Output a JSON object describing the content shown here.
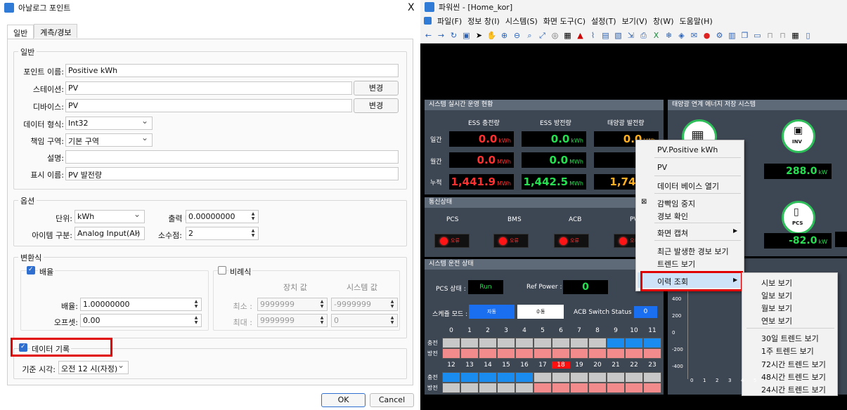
{
  "dialog": {
    "title": "아날로그 포인트",
    "close": "X",
    "tabs": [
      "일반",
      "계측/경보"
    ],
    "general": {
      "title": "일반",
      "point_name_label": "포인트 이름:",
      "point_name": "Positive kWh",
      "station_label": "스테이션:",
      "station": "PV",
      "station_btn": "변경",
      "device_label": "디바이스:",
      "device": "PV",
      "device_btn": "변경",
      "dtype_label": "데이터 형식:",
      "dtype": "Int32",
      "zone_label": "책임 구역:",
      "zone": "기본 구역",
      "desc_label": "설명:",
      "desc": "",
      "display_label": "표시 이름:",
      "display": "PV 발전량"
    },
    "options": {
      "title": "옵션",
      "unit_label": "단위:",
      "unit": "kWh",
      "mult_label": "출력 배율:",
      "mult": "0.00000000",
      "item_label": "아이템 구분:",
      "item": "Analog Input(AI)",
      "dec_label": "소수점:",
      "dec": "2"
    },
    "conversion": {
      "title": "변환식",
      "scale_title": "배율",
      "scale_label": "배율:",
      "scale": "1.00000000",
      "offset_label": "오프셋:",
      "offset": "0.00",
      "ratio_title": "비례식",
      "device_val": "장치 값",
      "system_val": "시스템 값",
      "min_label": "최소 :",
      "min_dev": "9999999",
      "min_sys": "-9999999",
      "max_label": "최대 :",
      "max_dev": "9999999",
      "max_sys": "0"
    },
    "record": {
      "title": "데이터 기록",
      "time_label": "기준 시각:",
      "time": "오전 12 시(자정)"
    },
    "ok": "OK",
    "cancel": "Cancel"
  },
  "app": {
    "title": "파워씬 - [Home_kor]",
    "menus": [
      "파일(F)",
      "정보 창(I)",
      "시스템(S)",
      "화면 도구(C)",
      "설정(T)",
      "보기(V)",
      "창(W)",
      "도움말(H)"
    ],
    "ops_panel": {
      "title": "시스템 실시간 운영 현황",
      "cols": [
        "ESS 충전량",
        "ESS 방전량",
        "태양광 발전량"
      ],
      "rows": [
        "일간",
        "월간",
        "누적"
      ],
      "values": [
        [
          "0.0",
          "0.0",
          "0.0"
        ],
        [
          "0.0",
          "0.0",
          "0."
        ],
        [
          "1,441.9",
          "1,442.5",
          "1,746.1"
        ]
      ],
      "units": [
        [
          "kWh",
          "kWh",
          "kWh"
        ],
        [
          "MWh",
          "MWh",
          ""
        ],
        [
          "MWh",
          "MWh",
          ""
        ]
      ]
    },
    "comm_panel": {
      "title": "통신상태",
      "items": [
        "PCS",
        "BMS",
        "ACB",
        "PV"
      ],
      "status": "오류"
    },
    "run_panel": {
      "title": "시스템 운전 상태",
      "pcs_label": "PCS 상태 :",
      "pcs": "Run",
      "ref_label": "Ref Power :",
      "ref": "0",
      "sched_label": "스케쥴 모드 :",
      "auto": "자동",
      "manual": "수동",
      "acb_label": "ACB Switch Status :",
      "acb": "0",
      "hours1": [
        "0",
        "1",
        "2",
        "3",
        "4",
        "5",
        "6",
        "7",
        "8",
        "9",
        "10",
        "11"
      ],
      "hours2": [
        "12",
        "13",
        "14",
        "15",
        "16",
        "17",
        "18",
        "19",
        "20",
        "21",
        "22",
        "23"
      ],
      "charge": "충전",
      "discharge": "방전",
      "current_hour": "18"
    },
    "solar_panel": {
      "title": "태양광 연계 에너지 저장 시스템",
      "inv_label": "INV",
      "inv_value": "288.0",
      "inv_unit": "kW",
      "pcs_label": "PCS",
      "pcs_value": "-82.0",
      "pcs_unit": "kW"
    },
    "chart": {
      "yticks": [
        "400",
        "200",
        "0",
        "-200",
        "-400"
      ],
      "xticks": [
        "0",
        "1",
        "2",
        "3",
        "4",
        "5"
      ]
    },
    "context_menu": {
      "items": [
        "PV.Positive kWh",
        "PV",
        "데이터 베이스 열기",
        "감빡임 중지",
        "경보 확인",
        "화면 캡쳐",
        "최근 발생한 경보 보기",
        "트렌드 보기",
        "이력 조회"
      ]
    },
    "submenu": {
      "items": [
        "시보 보기",
        "일보 보기",
        "월보 보기",
        "연보 보기",
        "30일 트렌드 보기",
        "1주 트렌드 보기",
        "72시간 트렌드 보기",
        "48시간 트렌드 보기",
        "24시간 트렌드 보기"
      ]
    }
  }
}
